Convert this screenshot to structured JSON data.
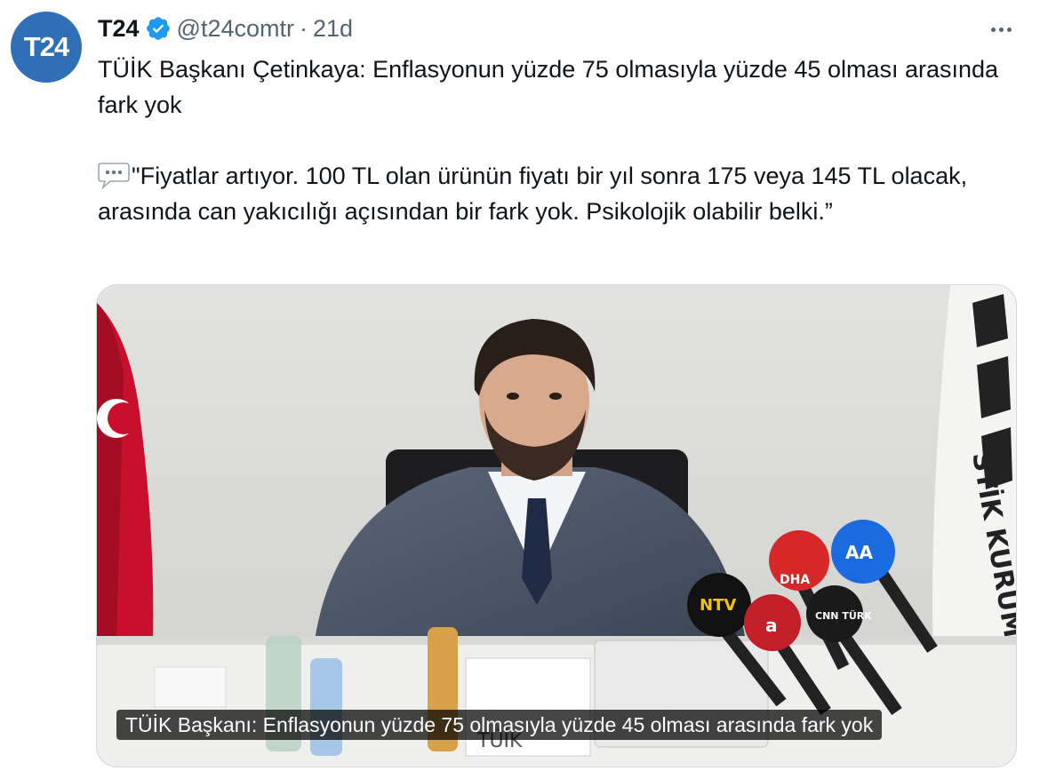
{
  "author": {
    "avatar_text": "T24",
    "name": "T24",
    "handle": "@t24comtr",
    "separator": "·",
    "time": "21d"
  },
  "tweet": {
    "line1": "TÜİK Başkanı Çetinkaya: Enflasyonun yüzde 75 olmasıyla yüzde 45 olması arasında fark yok",
    "emoji_name": "speech-balloon-icon",
    "quote": "\"Fiyatlar artıyor. 100 TL olan ürünün fiyatı bir yıl sonra 175 veya 145 TL olacak, arasında can yakıcılığı açısından bir fark yok. Psikolojik olabilir belki.”"
  },
  "media": {
    "caption": "TÜİK Başkanı: Enflasyonun yüzde 75 olmasıyla yüzde 45 olması arasında fark yok",
    "mic_labels": [
      "AA",
      "DHA",
      "NTV",
      "CNN TÜRK",
      "a"
    ],
    "wall_text": "STİK KURUMU",
    "desk_sign": "TÜİK"
  },
  "colors": {
    "accent": "#1d9bf0",
    "avatar_bg": "#2f6fb8",
    "secondary_text": "#536471"
  }
}
